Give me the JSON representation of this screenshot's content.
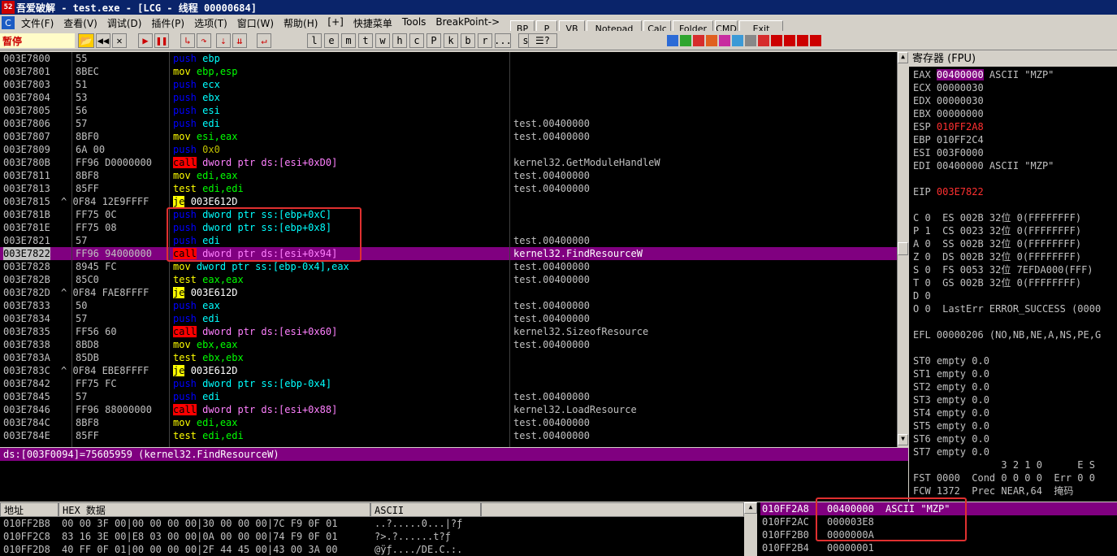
{
  "window": {
    "title": "吾爱破解 - test.exe - [LCG -  线程  00000684]"
  },
  "menu": [
    "文件(F)",
    "查看(V)",
    "调试(D)",
    "插件(P)",
    "选项(T)",
    "窗口(W)",
    "帮助(H)",
    "[+]",
    "快捷菜单",
    "Tools",
    "BreakPoint->"
  ],
  "toolbar": {
    "status": "暂停",
    "letters": [
      "l",
      "e",
      "m",
      "t",
      "w",
      "h",
      "c",
      "P",
      "k",
      "b",
      "r",
      "...",
      "s"
    ],
    "top_buttons": [
      "BP",
      "P",
      "VB",
      "Notepad",
      "Calc",
      "Folder",
      "CMD",
      "Exit"
    ]
  },
  "disasm": [
    {
      "addr": "003E7800",
      "hex": "55",
      "op": "push",
      "args": [
        [
          "ebp",
          "reg"
        ]
      ],
      "comment": ""
    },
    {
      "addr": "003E7801",
      "hex": "8BEC",
      "op": "mov",
      "args": [
        [
          "ebp,esp",
          "reg"
        ]
      ],
      "comment": ""
    },
    {
      "addr": "003E7803",
      "hex": "51",
      "op": "push",
      "args": [
        [
          "ecx",
          "reg"
        ]
      ],
      "comment": ""
    },
    {
      "addr": "003E7804",
      "hex": "53",
      "op": "push",
      "args": [
        [
          "ebx",
          "reg"
        ]
      ],
      "comment": ""
    },
    {
      "addr": "003E7805",
      "hex": "56",
      "op": "push",
      "args": [
        [
          "esi",
          "reg"
        ]
      ],
      "comment": ""
    },
    {
      "addr": "003E7806",
      "hex": "57",
      "op": "push",
      "args": [
        [
          "edi",
          "reg"
        ]
      ],
      "comment": "test.00400000"
    },
    {
      "addr": "003E7807",
      "hex": "8BF0",
      "op": "mov",
      "args": [
        [
          "esi,eax",
          "reg"
        ]
      ],
      "comment": "test.00400000"
    },
    {
      "addr": "003E7809",
      "hex": "6A 00",
      "op": "push",
      "args": [
        [
          "0x0",
          "imm"
        ]
      ],
      "comment": ""
    },
    {
      "addr": "003E780B",
      "hex": "FF96 D0000000",
      "op": "call",
      "args": [
        [
          "dword ptr ds:[esi+0xD0]",
          "mem"
        ]
      ],
      "comment": "kernel32.GetModuleHandleW"
    },
    {
      "addr": "003E7811",
      "hex": "8BF8",
      "op": "mov",
      "args": [
        [
          "edi,eax",
          "reg"
        ]
      ],
      "comment": "test.00400000"
    },
    {
      "addr": "003E7813",
      "hex": "85FF",
      "op": "test",
      "args": [
        [
          "edi,edi",
          "reg"
        ]
      ],
      "comment": "test.00400000"
    },
    {
      "addr": "003E7815",
      "hex": "^ 0F84 12E9FFFF",
      "op": "je",
      "args": [
        [
          "003E612D",
          "plain"
        ]
      ],
      "comment": ""
    },
    {
      "addr": "003E781B",
      "hex": "FF75 0C",
      "op": "push",
      "args": [
        [
          "dword ptr ss:[ebp+0xC]",
          "mem2"
        ]
      ],
      "comment": ""
    },
    {
      "addr": "003E781E",
      "hex": "FF75 08",
      "op": "push",
      "args": [
        [
          "dword ptr ss:[ebp+0x8]",
          "mem2"
        ]
      ],
      "comment": ""
    },
    {
      "addr": "003E7821",
      "hex": "57",
      "op": "push",
      "args": [
        [
          "edi",
          "reg"
        ]
      ],
      "comment": "test.00400000"
    },
    {
      "addr": "003E7822",
      "hex": "FF96 94000000",
      "op": "call",
      "args": [
        [
          "dword ptr ds:[esi+0x94]",
          "mem"
        ]
      ],
      "comment": "kernel32.FindResourceW",
      "selected": true
    },
    {
      "addr": "003E7828",
      "hex": "8945 FC",
      "op": "mov",
      "args": [
        [
          "dword ptr ss:[ebp-0x4],eax",
          "mem2"
        ]
      ],
      "comment": "test.00400000"
    },
    {
      "addr": "003E782B",
      "hex": "85C0",
      "op": "test",
      "args": [
        [
          "eax,eax",
          "reg"
        ]
      ],
      "comment": "test.00400000"
    },
    {
      "addr": "003E782D",
      "hex": "^ 0F84 FAE8FFFF",
      "op": "je",
      "args": [
        [
          "003E612D",
          "plain"
        ]
      ],
      "comment": ""
    },
    {
      "addr": "003E7833",
      "hex": "50",
      "op": "push",
      "args": [
        [
          "eax",
          "reg"
        ]
      ],
      "comment": "test.00400000"
    },
    {
      "addr": "003E7834",
      "hex": "57",
      "op": "push",
      "args": [
        [
          "edi",
          "reg"
        ]
      ],
      "comment": "test.00400000"
    },
    {
      "addr": "003E7835",
      "hex": "FF56 60",
      "op": "call",
      "args": [
        [
          "dword ptr ds:[esi+0x60]",
          "mem"
        ]
      ],
      "comment": "kernel32.SizeofResource"
    },
    {
      "addr": "003E7838",
      "hex": "8BD8",
      "op": "mov",
      "args": [
        [
          "ebx,eax",
          "reg"
        ]
      ],
      "comment": "test.00400000"
    },
    {
      "addr": "003E783A",
      "hex": "85DB",
      "op": "test",
      "args": [
        [
          "ebx,ebx",
          "reg"
        ]
      ],
      "comment": ""
    },
    {
      "addr": "003E783C",
      "hex": "^ 0F84 EBE8FFFF",
      "op": "je",
      "args": [
        [
          "003E612D",
          "plain"
        ]
      ],
      "comment": ""
    },
    {
      "addr": "003E7842",
      "hex": "FF75 FC",
      "op": "push",
      "args": [
        [
          "dword ptr ss:[ebp-0x4]",
          "mem2"
        ]
      ],
      "comment": ""
    },
    {
      "addr": "003E7845",
      "hex": "57",
      "op": "push",
      "args": [
        [
          "edi",
          "reg"
        ]
      ],
      "comment": "test.00400000"
    },
    {
      "addr": "003E7846",
      "hex": "FF96 88000000",
      "op": "call",
      "args": [
        [
          "dword ptr ds:[esi+0x88]",
          "mem"
        ]
      ],
      "comment": "kernel32.LoadResource"
    },
    {
      "addr": "003E784C",
      "hex": "8BF8",
      "op": "mov",
      "args": [
        [
          "edi,eax",
          "reg"
        ]
      ],
      "comment": "test.00400000"
    },
    {
      "addr": "003E784E",
      "hex": "85FF",
      "op": "test",
      "args": [
        [
          "edi,edi",
          "reg"
        ]
      ],
      "comment": "test.00400000"
    }
  ],
  "info_line": "ds:[003F0094]=75605959 (kernel32.FindResourceW)",
  "registers": {
    "header": "寄存器 (FPU)",
    "lines": [
      {
        "t": "EAX ",
        "v": "00400000",
        "cls": "hl",
        "r": " ASCII \"MZP\""
      },
      {
        "t": "ECX ",
        "v": "00000030",
        "cls": "",
        "r": ""
      },
      {
        "t": "EDX ",
        "v": "00000030",
        "cls": "",
        "r": ""
      },
      {
        "t": "EBX ",
        "v": "00000000",
        "cls": "",
        "r": ""
      },
      {
        "t": "ESP ",
        "v": "010FF2A8",
        "cls": "red",
        "r": ""
      },
      {
        "t": "EBP ",
        "v": "010FF2C4",
        "cls": "",
        "r": ""
      },
      {
        "t": "ESI ",
        "v": "003F0000",
        "cls": "",
        "r": ""
      },
      {
        "t": "EDI ",
        "v": "00400000",
        "cls": "",
        "r": " ASCII \"MZP\""
      },
      {
        "t": "",
        "v": "",
        "cls": "",
        "r": ""
      },
      {
        "t": "EIP ",
        "v": "003E7822",
        "cls": "red",
        "r": ""
      },
      {
        "t": "",
        "v": "",
        "cls": "",
        "r": ""
      },
      {
        "t": "C 0  ES 002B 32位 0(FFFFFFFF)",
        "v": "",
        "cls": "",
        "r": ""
      },
      {
        "t": "P 1  CS 0023 32位 0(FFFFFFFF)",
        "v": "",
        "cls": "",
        "r": ""
      },
      {
        "t": "A 0  SS 002B 32位 0(FFFFFFFF)",
        "v": "",
        "cls": "",
        "r": ""
      },
      {
        "t": "Z 0  DS 002B 32位 0(FFFFFFFF)",
        "v": "",
        "cls": "",
        "r": ""
      },
      {
        "t": "S 0  FS 0053 32位 7EFDA000(FFF)",
        "v": "",
        "cls": "",
        "r": ""
      },
      {
        "t": "T 0  GS 002B 32位 0(FFFFFFFF)",
        "v": "",
        "cls": "",
        "r": ""
      },
      {
        "t": "D 0",
        "v": "",
        "cls": "",
        "r": ""
      },
      {
        "t": "O 0  LastErr ERROR_SUCCESS (0000",
        "v": "",
        "cls": "",
        "r": ""
      },
      {
        "t": "",
        "v": "",
        "cls": "",
        "r": ""
      },
      {
        "t": "EFL 00000206 (NO,NB,NE,A,NS,PE,G",
        "v": "",
        "cls": "",
        "r": ""
      },
      {
        "t": "",
        "v": "",
        "cls": "",
        "r": ""
      },
      {
        "t": "ST0 empty 0.0",
        "v": "",
        "cls": "",
        "r": ""
      },
      {
        "t": "ST1 empty 0.0",
        "v": "",
        "cls": "",
        "r": ""
      },
      {
        "t": "ST2 empty 0.0",
        "v": "",
        "cls": "",
        "r": ""
      },
      {
        "t": "ST3 empty 0.0",
        "v": "",
        "cls": "",
        "r": ""
      },
      {
        "t": "ST4 empty 0.0",
        "v": "",
        "cls": "",
        "r": ""
      },
      {
        "t": "ST5 empty 0.0",
        "v": "",
        "cls": "",
        "r": ""
      },
      {
        "t": "ST6 empty 0.0",
        "v": "",
        "cls": "",
        "r": ""
      },
      {
        "t": "ST7 empty 0.0",
        "v": "",
        "cls": "",
        "r": ""
      },
      {
        "t": "               3 2 1 0      E S",
        "v": "",
        "cls": "",
        "r": ""
      },
      {
        "t": "FST 0000  Cond 0 0 0 0  Err 0 0",
        "v": "",
        "cls": "",
        "r": ""
      },
      {
        "t": "FCW 1372  Prec NEAR,64  掩码",
        "v": "",
        "cls": "",
        "r": ""
      }
    ]
  },
  "dump": {
    "headers": [
      "地址",
      "HEX 数据",
      "ASCII"
    ],
    "rows": [
      {
        "addr": "010FF2B8",
        "hex": "00 00 3F 00|00 00 00 00|30 00 00 00|7C F9 0F 01",
        "ascii": "..?.....0...|?ƒ"
      },
      {
        "addr": "010FF2C8",
        "hex": "83 16 3E 00|E8 03 00 00|0A 00 00 00|74 F9 0F 01",
        "ascii": "?>.?......t?ƒ"
      },
      {
        "addr": "010FF2D8",
        "hex": "40 FF 0F 01|00 00 00 00|2F 44 45 00|43 00 3A 00",
        "ascii": "@ÿƒ..../DE.C.:."
      }
    ]
  },
  "stack": [
    {
      "addr": "010FF2A8",
      "val": "00400000",
      "comment": "ASCII \"MZP\"",
      "selected": true
    },
    {
      "addr": "010FF2AC",
      "val": "000003E8",
      "comment": ""
    },
    {
      "addr": "010FF2B0",
      "val": "0000000A",
      "comment": ""
    },
    {
      "addr": "010FF2B4",
      "val": "00000001",
      "comment": ""
    }
  ]
}
